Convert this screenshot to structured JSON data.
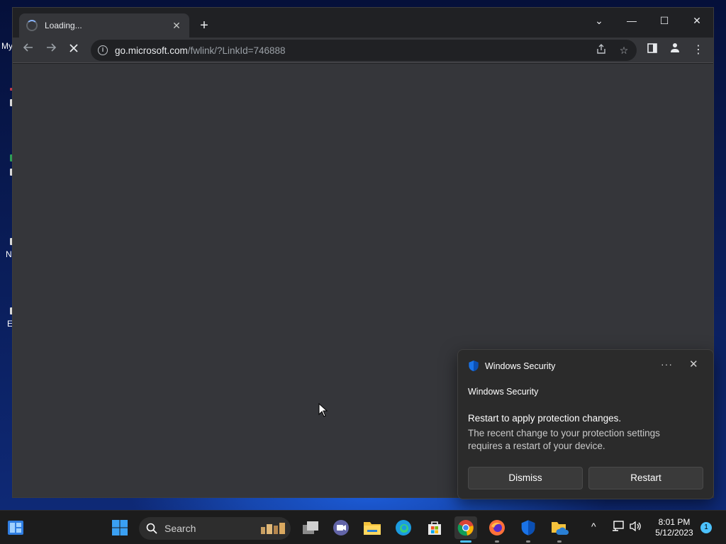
{
  "desktop": {
    "icon_labels": [
      "My",
      "N",
      "E"
    ]
  },
  "browser": {
    "tab": {
      "title": "Loading...",
      "close": "✕"
    },
    "new_tab": "+",
    "window_controls": {
      "tab_search": "⌄",
      "minimize": "—",
      "maximize": "☐",
      "close": "✕"
    },
    "address": {
      "host": "go.microsoft.com",
      "path": "/fwlink/?LinkId=746888"
    }
  },
  "toast": {
    "app_name": "Windows Security",
    "more": "···",
    "close": "✕",
    "source": "Windows Security",
    "title": "Restart to apply protection changes.",
    "body": "The recent change to your protection settings requires a restart of your device.",
    "buttons": {
      "dismiss": "Dismiss",
      "restart": "Restart"
    }
  },
  "taskbar": {
    "search_label": "Search",
    "clock": {
      "time": "8:01 PM",
      "date": "5/12/2023"
    },
    "notification_count": "1"
  },
  "colors": {
    "window_bg": "#202124",
    "content_bg": "#35363a",
    "toast_bg": "#2b2b2b",
    "accent": "#4cc2ff",
    "shield_blue": "#1a73e8"
  }
}
